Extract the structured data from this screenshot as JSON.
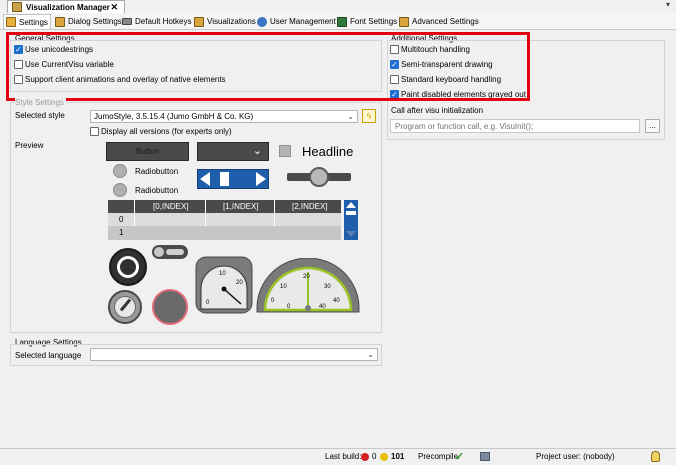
{
  "doc_tab": {
    "title": "Visualization Manager",
    "close": "✕"
  },
  "doc_menu": "▾",
  "tabs": [
    {
      "label": "Settings",
      "icon": "settings-icon"
    },
    {
      "label": "Dialog Settings",
      "icon": "dialog-icon"
    },
    {
      "label": "Default Hotkeys",
      "icon": "keyboard-icon"
    },
    {
      "label": "Visualizations",
      "icon": "visualization-icon"
    },
    {
      "label": "User Management",
      "icon": "users-icon"
    },
    {
      "label": "Font Settings",
      "icon": "font-icon"
    },
    {
      "label": "Advanced Settings",
      "icon": "advanced-icon"
    }
  ],
  "general": {
    "title": "General Settings",
    "items": [
      {
        "label": "Use unicodestrings",
        "checked": true
      },
      {
        "label": "Use CurrentVisu variable",
        "checked": false
      },
      {
        "label": "Support client animations and overlay of native elements",
        "checked": false
      }
    ]
  },
  "additional": {
    "title": "Additional Settings",
    "items": [
      {
        "label": "Multitouch handling",
        "checked": false
      },
      {
        "label": "Semi-transparent drawing",
        "checked": true
      },
      {
        "label": "Standard keyboard handling",
        "checked": false
      },
      {
        "label": "Paint disabled elements grayed out",
        "checked": true
      }
    ]
  },
  "call_after": {
    "label": "Call after visu initialization",
    "placeholder": "Program or function call, e.g. VisuInit();",
    "button": "..."
  },
  "style": {
    "title": "Style Settings",
    "selected_label": "Selected style",
    "selected_value": "JumoStyle, 3.5.15.4 (Jumo GmbH & Co. KG)",
    "display_all": "Display all versions (for experts only)",
    "preview_label": "Preview"
  },
  "preview": {
    "button": "Button",
    "headline": "Headline",
    "radio1": "Radiobutton",
    "radio2": "Radiobutton",
    "table_headers": [
      "[0,INDEX]",
      "[1,INDEX]",
      "[2,INDEX]"
    ],
    "table_rows": [
      "0",
      "1"
    ],
    "gauge_small_labels": [
      "0",
      "10",
      "20"
    ],
    "gauge_big_labels": [
      "0",
      "10",
      "20",
      "30",
      "40",
      "0",
      "40"
    ]
  },
  "language": {
    "title": "Language Settings",
    "selected_label": "Selected language",
    "selected_value": ""
  },
  "status": {
    "last_build": "Last build:",
    "errors": "0",
    "warnings": "101",
    "precompile": "Precompile",
    "project_user": "Project user: (nobody)"
  },
  "colors": {
    "accent": "#1e6ecf",
    "highlight": "#e3000f",
    "preview_blue": "#1f5eab",
    "preview_dark": "#4a4a4a"
  }
}
